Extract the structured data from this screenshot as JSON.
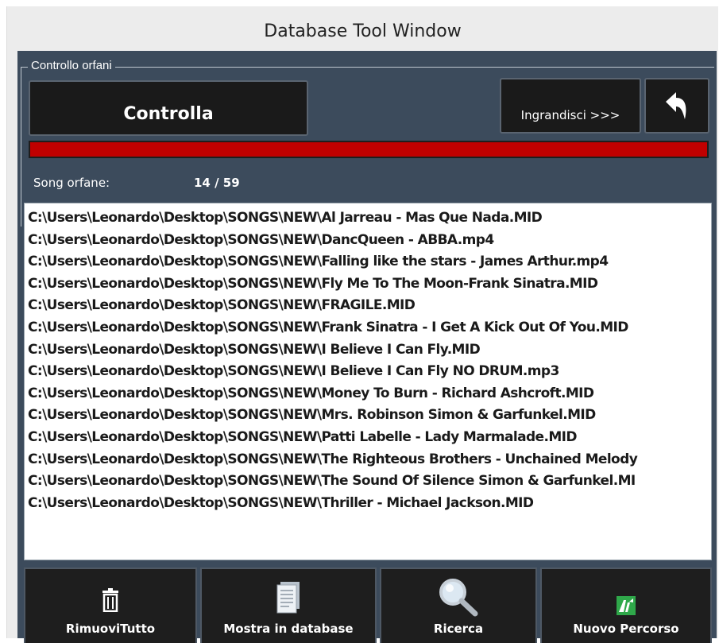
{
  "window": {
    "title": "Database Tool Window"
  },
  "group": {
    "legend": "Controllo orfani"
  },
  "buttons": {
    "check": "Controlla",
    "enlarge": "Ingrandisci >>>",
    "back_icon": "back-arrow-icon"
  },
  "progress": {
    "fraction": 1.0,
    "color": "#c00000"
  },
  "orphans": {
    "label": "Song orfane:",
    "count": "14 / 59",
    "files": [
      "C:\\Users\\Leonardo\\Desktop\\SONGS\\NEW\\Al Jarreau - Mas Que Nada.MID",
      "C:\\Users\\Leonardo\\Desktop\\SONGS\\NEW\\DancQueen - ABBA.mp4",
      "C:\\Users\\Leonardo\\Desktop\\SONGS\\NEW\\Falling like the stars - James Arthur.mp4",
      "C:\\Users\\Leonardo\\Desktop\\SONGS\\NEW\\Fly Me To The Moon-Frank Sinatra.MID",
      "C:\\Users\\Leonardo\\Desktop\\SONGS\\NEW\\FRAGILE.MID",
      "C:\\Users\\Leonardo\\Desktop\\SONGS\\NEW\\Frank Sinatra - I Get A Kick Out Of You.MID",
      "C:\\Users\\Leonardo\\Desktop\\SONGS\\NEW\\I Believe I Can Fly.MID",
      "C:\\Users\\Leonardo\\Desktop\\SONGS\\NEW\\I Believe I Can Fly NO DRUM.mp3",
      "C:\\Users\\Leonardo\\Desktop\\SONGS\\NEW\\Money To Burn - Richard Ashcroft.MID",
      "C:\\Users\\Leonardo\\Desktop\\SONGS\\NEW\\Mrs. Robinson Simon & Garfunkel.MID",
      "C:\\Users\\Leonardo\\Desktop\\SONGS\\NEW\\Patti Labelle - Lady Marmalade.MID",
      "C:\\Users\\Leonardo\\Desktop\\SONGS\\NEW\\The Righteous Brothers - Unchained Melody",
      "C:\\Users\\Leonardo\\Desktop\\SONGS\\NEW\\The Sound Of Silence Simon & Garfunkel.MI",
      "C:\\Users\\Leonardo\\Desktop\\SONGS\\NEW\\Thriller - Michael Jackson.MID"
    ]
  },
  "toolbar": {
    "remove_all": {
      "label": "RimuoviTutto",
      "icon": "trash-icon"
    },
    "show_in_db": {
      "label": "Mostra in database",
      "icon": "document-icon"
    },
    "search": {
      "label": "Ricerca",
      "icon": "magnifier-icon"
    },
    "new_path": {
      "label": "Nuovo Percorso",
      "icon": "new-path-icon"
    }
  }
}
